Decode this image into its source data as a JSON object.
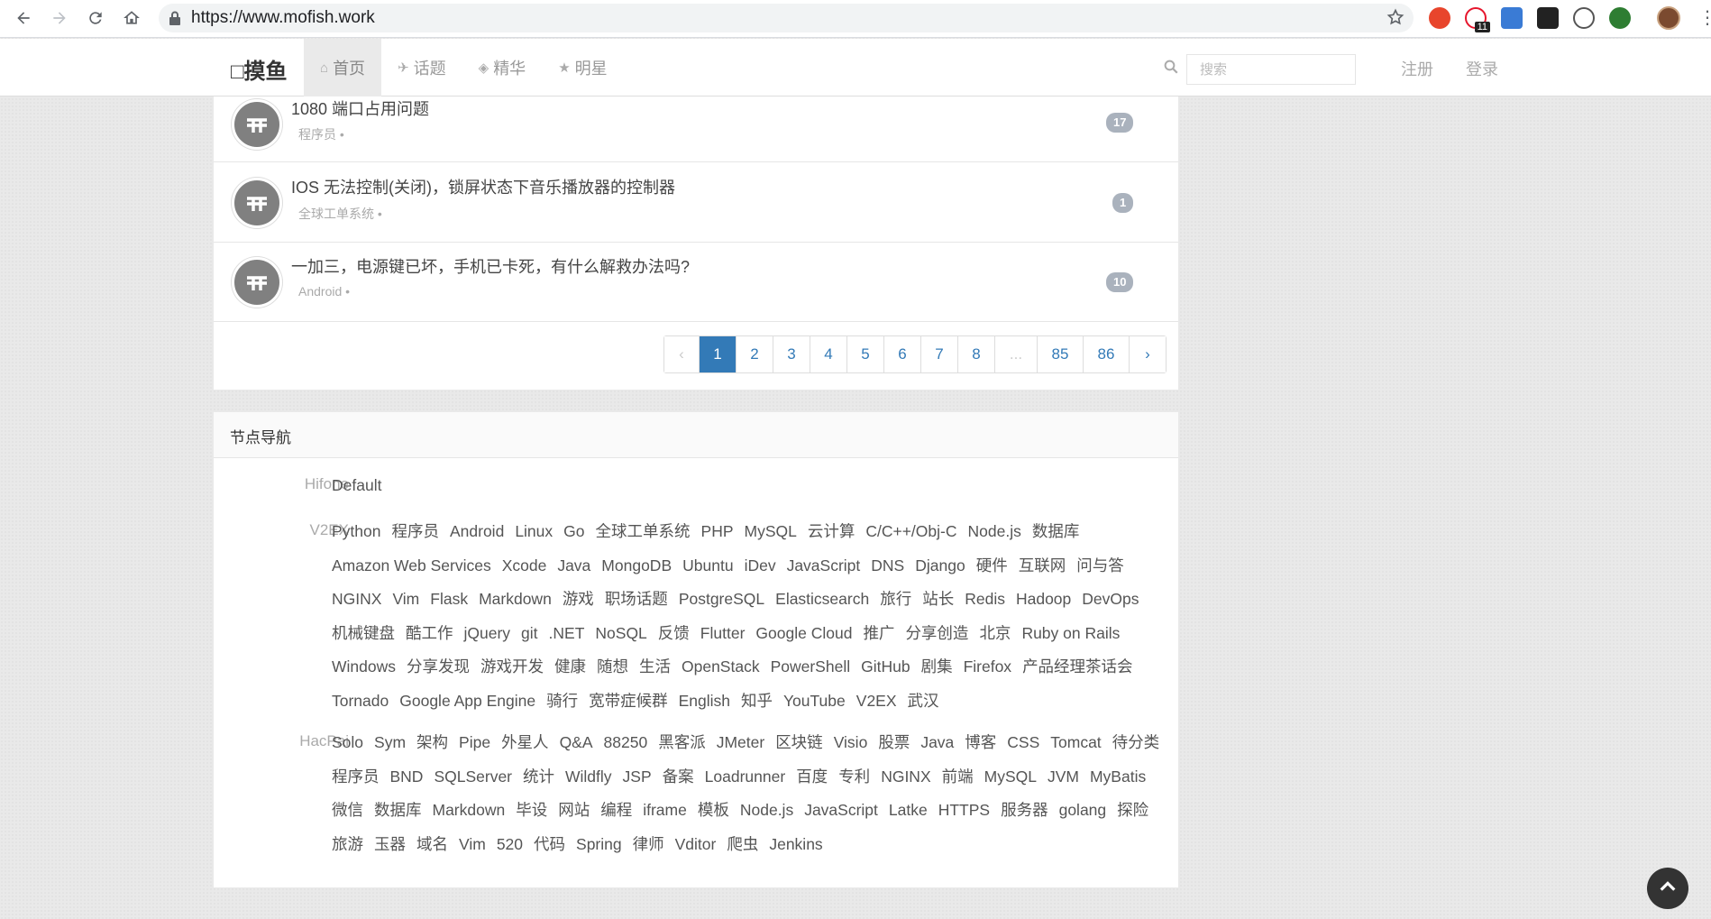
{
  "browser": {
    "url": "https://www.mofish.work",
    "ext_badge": "11"
  },
  "header": {
    "brand": "□摸鱼",
    "tabs": [
      {
        "label": "首页",
        "icon": "home-icon"
      },
      {
        "label": "话题",
        "icon": "comments-icon"
      },
      {
        "label": "精华",
        "icon": "diamond-icon"
      },
      {
        "label": "明星",
        "icon": "star-icon"
      }
    ],
    "search_placeholder": "搜索",
    "register": "注册",
    "login": "登录"
  },
  "topics": [
    {
      "title": "1080 端口占用问题",
      "node": "程序员 •",
      "count": "17"
    },
    {
      "title": "IOS 无法控制(关闭)，锁屏状态下音乐播放器的控制器",
      "node": "全球工单系统 •",
      "count": "1"
    },
    {
      "title": "一加三，电源键已坏，手机已卡死，有什么解救办法吗?",
      "node": "Android •",
      "count": "10"
    }
  ],
  "pagination": [
    "‹",
    "1",
    "2",
    "3",
    "4",
    "5",
    "6",
    "7",
    "8",
    "...",
    "85",
    "86",
    "›"
  ],
  "node_nav": {
    "title": "节点导航",
    "groups": [
      {
        "label": "Hifone",
        "lines": [
          [
            "Default"
          ]
        ]
      },
      {
        "label": "V2EX",
        "lines": [
          [
            "Python",
            "程序员",
            "Android",
            "Linux",
            "Go",
            "全球工单系统",
            "PHP",
            "MySQL",
            "云计算",
            "C/C++/Obj-C",
            "Node.js",
            "数据库"
          ],
          [
            "Amazon Web Services",
            "Xcode",
            "Java",
            "MongoDB",
            "Ubuntu",
            "iDev",
            "JavaScript",
            "DNS",
            "Django",
            "硬件",
            "互联网",
            "问与答"
          ],
          [
            "NGINX",
            "Vim",
            "Flask",
            "Markdown",
            "游戏",
            "职场话题",
            "PostgreSQL",
            "Elasticsearch",
            "旅行",
            "站长",
            "Redis",
            "Hadoop",
            "DevOps"
          ],
          [
            "机械键盘",
            "酷工作",
            "jQuery",
            "git",
            ".NET",
            "NoSQL",
            "反馈",
            "Flutter",
            "Google Cloud",
            "推广",
            "分享创造",
            "北京",
            "Ruby on Rails"
          ],
          [
            "Windows",
            "分享发现",
            "游戏开发",
            "健康",
            "随想",
            "生活",
            "OpenStack",
            "PowerShell",
            "GitHub",
            "剧集",
            "Firefox",
            "产品经理茶话会"
          ],
          [
            "Tornado",
            "Google App Engine",
            "骑行",
            "宽带症候群",
            "English",
            "知乎",
            "YouTube",
            "V2EX",
            "武汉"
          ]
        ]
      },
      {
        "label": "HacPai",
        "lines": [
          [
            "Solo",
            "Sym",
            "架构",
            "Pipe",
            "外星人",
            "Q&A",
            "88250",
            "黑客派",
            "JMeter",
            "区块链",
            "Visio",
            "股票",
            "Java",
            "博客",
            "CSS",
            "Tomcat",
            "待分类"
          ],
          [
            "程序员",
            "BND",
            "SQLServer",
            "统计",
            "Wildfly",
            "JSP",
            "备案",
            "Loadrunner",
            "百度",
            "专利",
            "NGINX",
            "前端",
            "MySQL",
            "JVM",
            "MyBatis"
          ],
          [
            "微信",
            "数据库",
            "Markdown",
            "毕设",
            "网站",
            "编程",
            "iframe",
            "模板",
            "Node.js",
            "JavaScript",
            "Latke",
            "HTTPS",
            "服务器",
            "golang",
            "探险"
          ],
          [
            "旅游",
            "玉器",
            "域名",
            "Vim",
            "520",
            "代码",
            "Spring",
            "律师",
            "Vditor",
            "爬虫",
            "Jenkins"
          ]
        ]
      }
    ]
  },
  "colors": {
    "accent": "#337ab7",
    "badge": "#aab2bd",
    "page_bg": "#e9e9e9"
  }
}
